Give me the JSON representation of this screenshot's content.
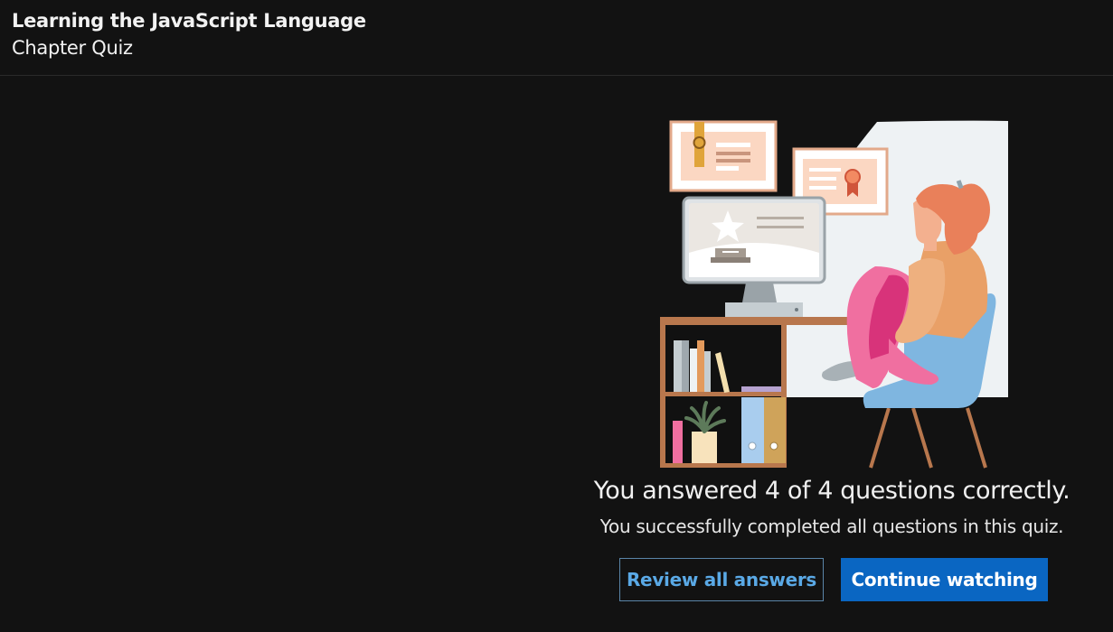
{
  "header": {
    "course_title": "Learning the JavaScript Language",
    "chapter_title": "Chapter Quiz"
  },
  "result": {
    "main_text": "You answered 4 of 4 questions correctly.",
    "sub_text": "You successfully completed all questions in this quiz.",
    "correct": 4,
    "total": 4
  },
  "actions": {
    "review_label": "Review all answers",
    "continue_label": "Continue watching"
  },
  "colors": {
    "background": "#121212",
    "primary_button": "#0a66c2",
    "secondary_button_text": "#5aa9e6"
  }
}
